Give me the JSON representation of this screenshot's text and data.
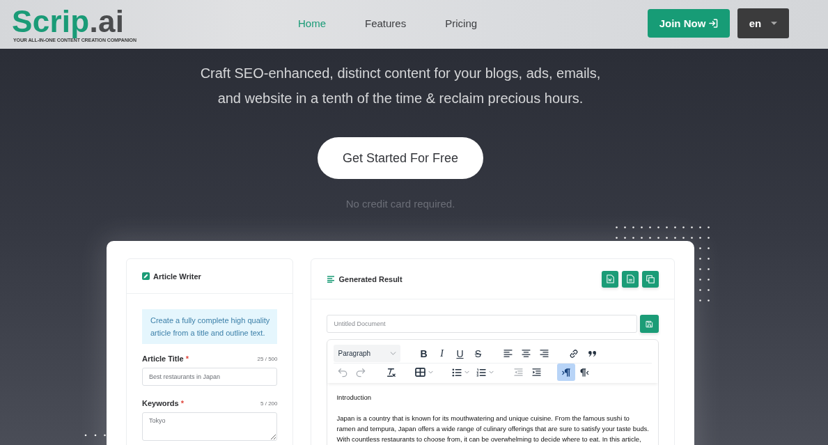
{
  "header": {
    "logo": {
      "name": "Scrip",
      "suffix": ".ai",
      "tagline": "YOUR ALL-IN-ONE CONTENT CREATION COMPANION"
    },
    "nav": [
      {
        "label": "Home",
        "selected": true
      },
      {
        "label": "Features",
        "selected": false
      },
      {
        "label": "Pricing",
        "selected": false
      }
    ],
    "join_button": {
      "label": "Join Now"
    },
    "language": {
      "value": "en"
    }
  },
  "hero": {
    "text": "Craft SEO-enhanced, distinct content for your blogs, ads, emails,\nand website in a tenth of the time & reclaim precious hours.",
    "cta": "Get Started For Free",
    "note": "No credit card required."
  },
  "demo": {
    "article_writer": {
      "title": "Article Writer",
      "info": "Create a fully complete high quality article from a title and outline text.",
      "fields": [
        {
          "kind": "input",
          "label": "Article Title",
          "required_mark": "*",
          "counter": "25 / 500",
          "value": "Best restaurants in Japan"
        },
        {
          "kind": "textarea",
          "label": "Keywords",
          "required_mark": "*",
          "counter": "5 / 200",
          "value": "Tokyo"
        }
      ]
    },
    "result": {
      "title": "Generated Result",
      "actions": [
        {
          "kind": "word"
        },
        {
          "kind": "document"
        },
        {
          "kind": "copy"
        }
      ],
      "document_name": {
        "placeholder": "Untitled Document"
      },
      "toolbar": {
        "block_format": "Paragraph",
        "rows": [
          {
            "groups": [
              {
                "items": [
                  {
                    "kind": "bold",
                    "label": "B",
                    "active": false,
                    "disabled": false
                  },
                  {
                    "kind": "italic",
                    "label": "I",
                    "active": false,
                    "disabled": false
                  },
                  {
                    "kind": "underline",
                    "label": "U",
                    "active": false,
                    "disabled": false
                  },
                  {
                    "kind": "strike",
                    "label": "S",
                    "active": false,
                    "disabled": false
                  }
                ]
              },
              {
                "items": [
                  {
                    "kind": "align-left",
                    "active": false,
                    "disabled": false
                  },
                  {
                    "kind": "align-center",
                    "active": false,
                    "disabled": false
                  },
                  {
                    "kind": "align-right",
                    "active": false,
                    "disabled": false
                  }
                ]
              },
              {
                "items": [
                  {
                    "kind": "link",
                    "active": false,
                    "disabled": false
                  },
                  {
                    "kind": "quote",
                    "active": false,
                    "disabled": false
                  }
                ]
              }
            ]
          },
          {
            "groups": [
              {
                "items": [
                  {
                    "kind": "undo",
                    "active": false,
                    "disabled": true
                  },
                  {
                    "kind": "redo",
                    "active": false,
                    "disabled": true
                  }
                ]
              },
              {
                "items": [
                  {
                    "kind": "clear-format",
                    "active": false,
                    "disabled": false
                  }
                ]
              },
              {
                "items": [
                  {
                    "kind": "table",
                    "active": false,
                    "disabled": false
                  }
                ]
              },
              {
                "items": [
                  {
                    "kind": "bullet-list",
                    "active": false,
                    "disabled": false
                  },
                  {
                    "kind": "numbered-list",
                    "active": false,
                    "disabled": false
                  }
                ]
              },
              {
                "items": [
                  {
                    "kind": "outdent",
                    "active": false,
                    "disabled": true
                  },
                  {
                    "kind": "indent",
                    "active": false,
                    "disabled": false
                  }
                ]
              },
              {
                "items": [
                  {
                    "kind": "ltr",
                    "active": true,
                    "disabled": false
                  },
                  {
                    "kind": "rtl",
                    "active": false,
                    "disabled": false
                  }
                ]
              }
            ]
          }
        ]
      },
      "content": {
        "heading": "Introduction",
        "paragraph": "Japan is a country that is known for its mouthwatering and unique cuisine. From the famous sushi to\nramen and tempura, Japan offers a wide range of culinary offerings that are sure to satisfy your taste buds.\nWith countless restaurants to choose from, it can be overwhelming to decide where to eat. In this article,"
      }
    }
  }
}
